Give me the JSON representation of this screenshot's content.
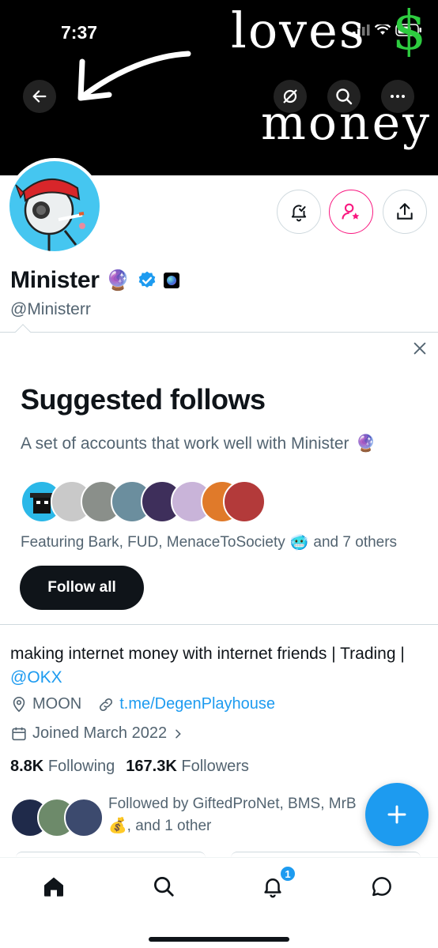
{
  "status_bar": {
    "time": "7:37"
  },
  "banner": {
    "handwriting_top": "loves",
    "handwriting_bottom": "money",
    "dollar_sign": "$",
    "back_icon": "back-arrow-icon",
    "translate_icon": "no-translate-icon",
    "search_icon": "search-icon",
    "more_icon": "more-icon"
  },
  "profile": {
    "name": "Minister",
    "name_emoji": "🔮",
    "handle": "@Ministerr",
    "verified_color": "#1d9bf0",
    "actions": [
      "notify-icon",
      "follow-icon",
      "share-icon"
    ]
  },
  "suggested": {
    "title": "Suggested follows",
    "description": "A set of accounts that work well with Minister",
    "description_emoji": "🔮",
    "featuring_text": "Featuring Bark, FUD, MenaceToSociety",
    "featuring_emoji": "🥶",
    "featuring_suffix": "and 7 others",
    "follow_all_label": "Follow all",
    "avatar_colors": [
      "#2bb8e8",
      "#c9c9c9",
      "#8a8f8a",
      "#6b8e9e",
      "#3e2f5b",
      "#c9b4d9",
      "#e07a2a",
      "#b33a3a"
    ]
  },
  "bio": {
    "text": "making internet money with internet friends | Trading | ",
    "mention": "@OKX",
    "location": "MOON",
    "website": "t.me/DegenPlayhouse",
    "joined": "Joined March 2022",
    "following_count": "8.8K",
    "following_label": "Following",
    "followers_count": "167.3K",
    "followers_label": "Followers",
    "followed_by": "Followed by GiftedProNet, BMS, MrB",
    "followed_by_emoji": "💰",
    "followed_by_suffix": ", and 1 other"
  },
  "accent_color": "#1d9bf0",
  "bottom_nav": {
    "items": [
      "home-icon",
      "search-icon",
      "notifications-icon",
      "messages-icon"
    ],
    "notification_badge": "1"
  }
}
